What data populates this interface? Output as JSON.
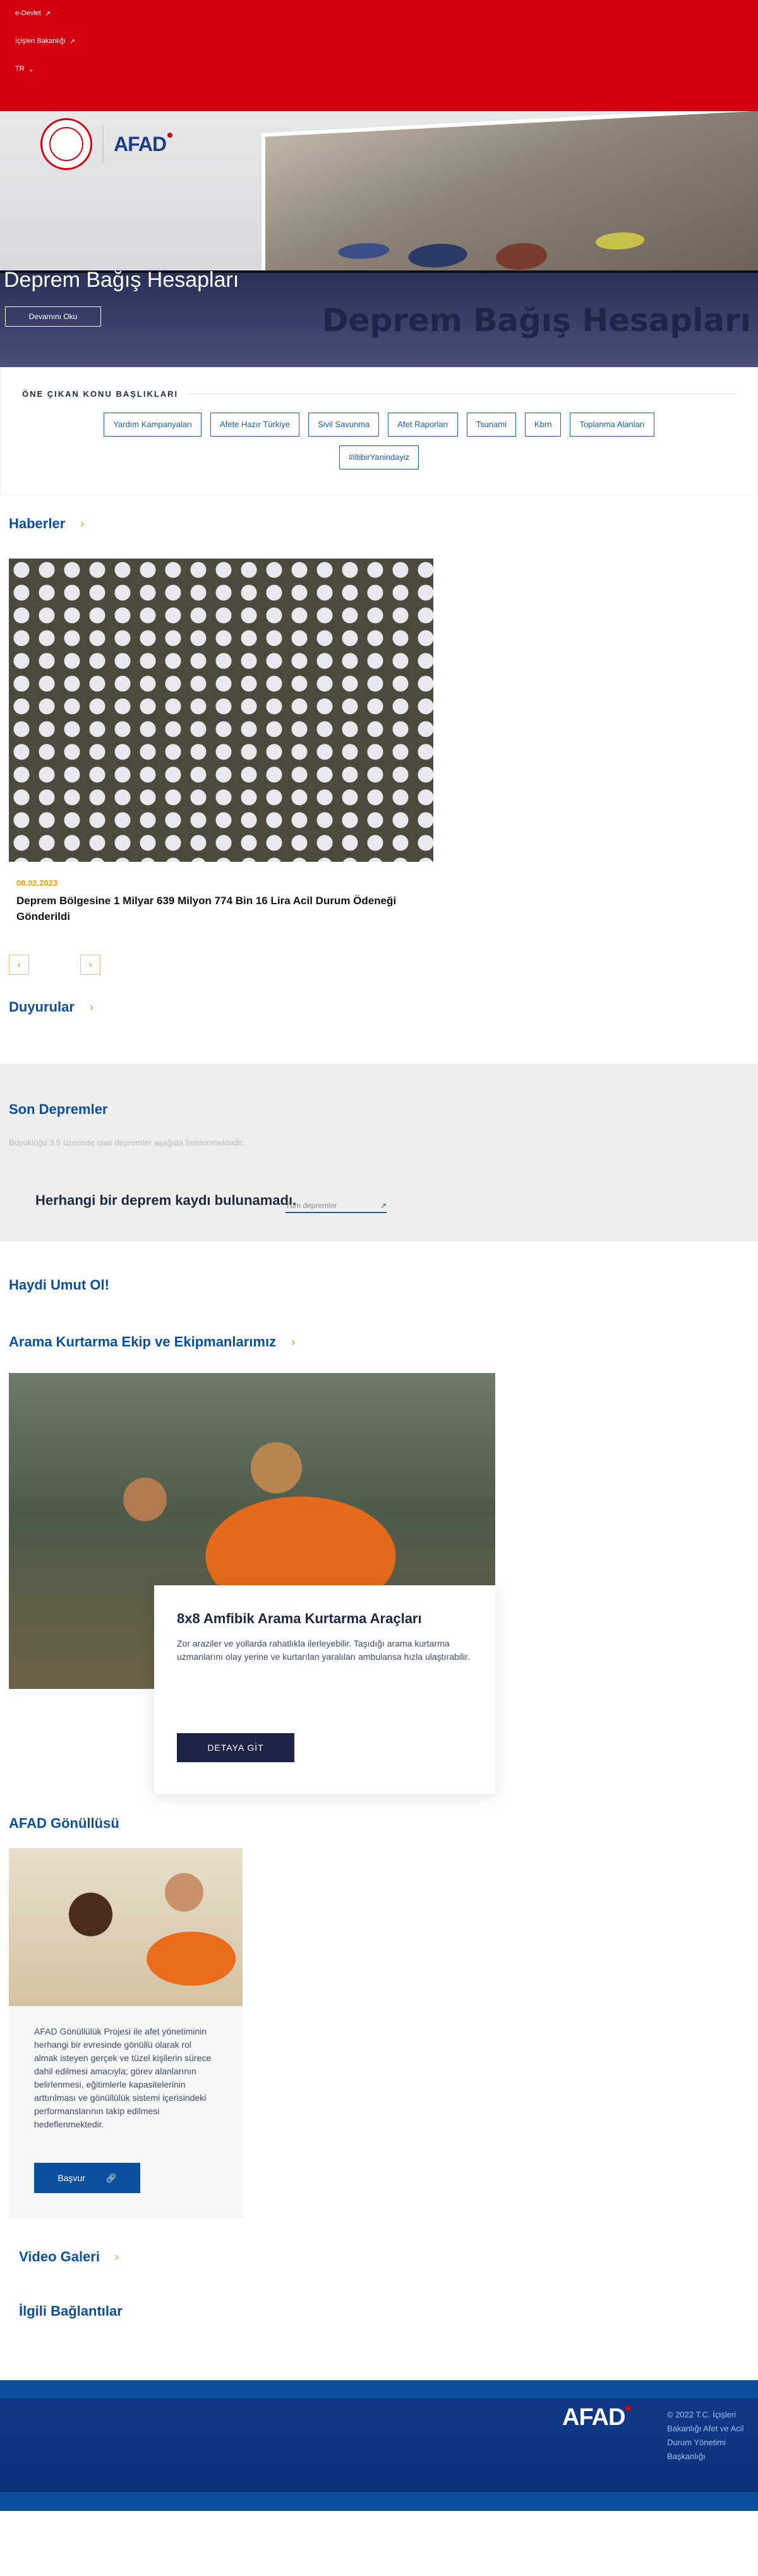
{
  "topbar": {
    "edevlet": "e-Devlet",
    "ministry": "İçişleri Bakanlığı",
    "lang": "TR"
  },
  "hero": {
    "logo_text": "AFAD",
    "banner_text": "Deprem Bağış Hesapları",
    "title": "Deprem Bağış Hesapları",
    "button": "Devamını Oku"
  },
  "topics": {
    "heading": "ÖNE ÇIKAN KONU BAŞLIKLARI",
    "tags": [
      "Yardım Kampanyaları",
      "Afete Hazır Türkiye",
      "Sivil Savunma",
      "Afet Raporları",
      "Tsunami",
      "Kbrn",
      "Toplanma Alanları",
      "#iltibirYanindayiz"
    ]
  },
  "news": {
    "heading": "Haberler",
    "date": "08.02.2023",
    "title": "Deprem Bölgesine 1 Milyar 639 Milyon 774 Bin 16 Lira Acil Durum Ödeneği Gönderildi"
  },
  "announcements": {
    "heading": "Duyurular"
  },
  "quakes": {
    "heading": "Son Depremler",
    "description": "Büyüklüğü 3.5 üzerinde olan depremler aşağıda listelenmektedir.",
    "empty": "Herhangi bir deprem kaydı bulunamadı.",
    "all_link": "Tüm depremler"
  },
  "hope": {
    "heading": "Haydi Umut Ol!"
  },
  "rescue": {
    "heading": "Arama Kurtarma Ekip ve Ekipmanlarımız",
    "card_title": "8x8 Amfibik Arama Kurtarma Araçları",
    "card_text": "Zor araziler ve yollarda rahatlıkla ilerleyebilir. Taşıdığı arama kurtarma uzmanlarını olay yerine ve kurtarılan yaralıları ambulansa hızla ulaştırabilir.",
    "button": "DETAYA GİT"
  },
  "volunteer": {
    "heading": "AFAD Gönüllüsü",
    "text": "AFAD Gönüllülük Projesi ile afet yönetiminin herhangi bir evresinde gönüllü olarak rol almak isteyen gerçek ve tüzel kişilerin sürece dahil edilmesi amacıyla; görev alanlarının belirlenmesi, eğitimlerle kapasitelerinin arttırılması ve gönüllülük sistemi içerisindeki performanslarının takip edilmesi hedeflenmektedir.",
    "button": "Başvur"
  },
  "video": {
    "heading": "Video Galeri"
  },
  "links": {
    "heading": "İlgili Bağlantılar"
  },
  "footer": {
    "logo_text": "AFAD",
    "copyright": "© 2022 T.C. İçişleri Bakanlığı Afet ve Acil Durum Yönetimi Başkanlığı"
  },
  "colors": {
    "brand_red": "#d3000f",
    "brand_blue": "#0a4e9e",
    "accent_orange": "#f08c00",
    "navy": "#1e2548"
  }
}
